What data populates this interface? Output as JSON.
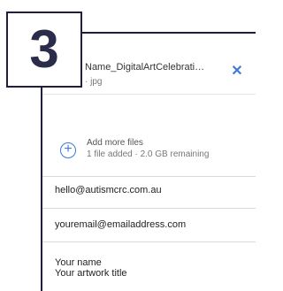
{
  "step": {
    "number": "3"
  },
  "file": {
    "name": "Name_DigitalArtCelebration.jpg",
    "meta": "· jpg",
    "remove_icon": "close-icon"
  },
  "add_more": {
    "icon": "plus-circle-icon",
    "title": "Add more files",
    "subtitle": "1 file added · 2.0 GB remaining"
  },
  "form": {
    "to_email": "hello@autismcrc.com.au",
    "from_email": "youremail@emailaddress.com",
    "message_line1": "Your name",
    "message_line2": "Your artwork title"
  },
  "colors": {
    "frame": "#1f1f3d",
    "accent": "#3e7ad8"
  }
}
